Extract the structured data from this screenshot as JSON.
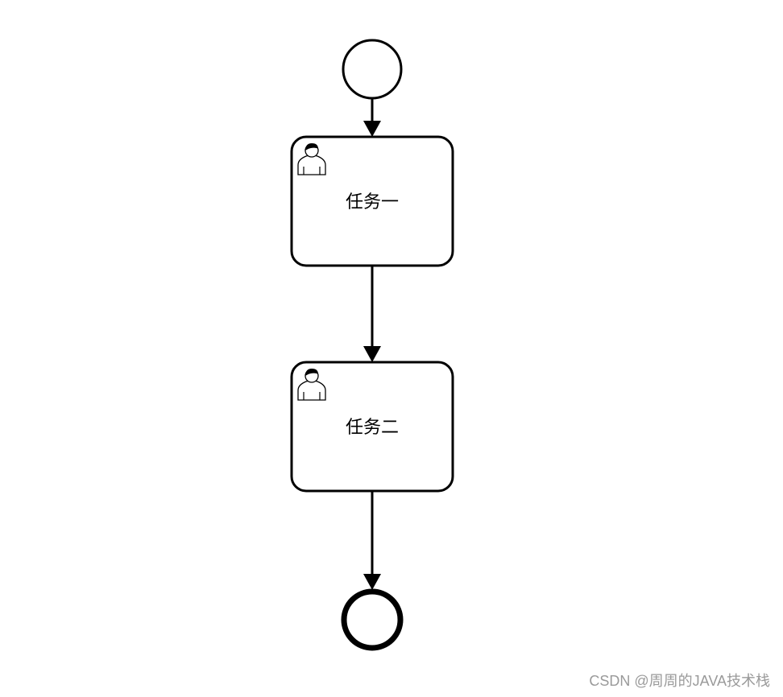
{
  "diagram": {
    "start_event": {},
    "tasks": [
      {
        "label": "任务一",
        "icon": "user-icon"
      },
      {
        "label": "任务二",
        "icon": "user-icon"
      }
    ],
    "end_event": {},
    "stroke_color": "#000000"
  },
  "watermark": "CSDN @周周的JAVA技术栈"
}
